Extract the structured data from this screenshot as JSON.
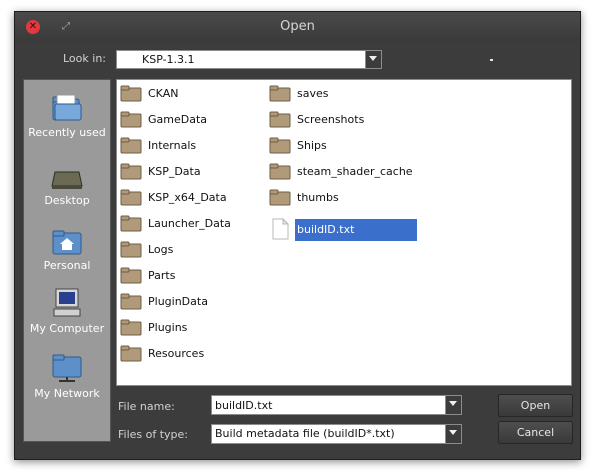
{
  "window": {
    "title": "Open"
  },
  "lookin": {
    "label": "Look in:",
    "value": "KSP-1.3.1"
  },
  "places": [
    {
      "label": "Recently used",
      "icon": "recent-folder-icon"
    },
    {
      "label": "Desktop",
      "icon": "desktop-icon"
    },
    {
      "label": "Personal",
      "icon": "home-folder-icon"
    },
    {
      "label": "My Computer",
      "icon": "computer-icon"
    },
    {
      "label": "My Network",
      "icon": "network-folder-icon"
    }
  ],
  "files": {
    "column1": [
      "CKAN",
      "GameData",
      "Internals",
      "KSP_Data",
      "KSP_x64_Data",
      "Launcher_Data",
      "Logs",
      "Parts",
      "PluginData",
      "Plugins",
      "Resources"
    ],
    "column2": [
      "saves",
      "Screenshots",
      "Ships",
      "steam_shader_cache",
      "thumbs",
      "buildID.txt"
    ],
    "selected": "buildID.txt"
  },
  "filename": {
    "label": "File name:",
    "value": "buildID.txt"
  },
  "filetype": {
    "label": "Files of type:",
    "value": "Build metadata file (buildID*.txt)"
  },
  "buttons": {
    "open": "Open",
    "cancel": "Cancel"
  },
  "colors": {
    "selection": "#3b6fcc",
    "close": "#e0393e",
    "folder": "#b09a7a"
  }
}
